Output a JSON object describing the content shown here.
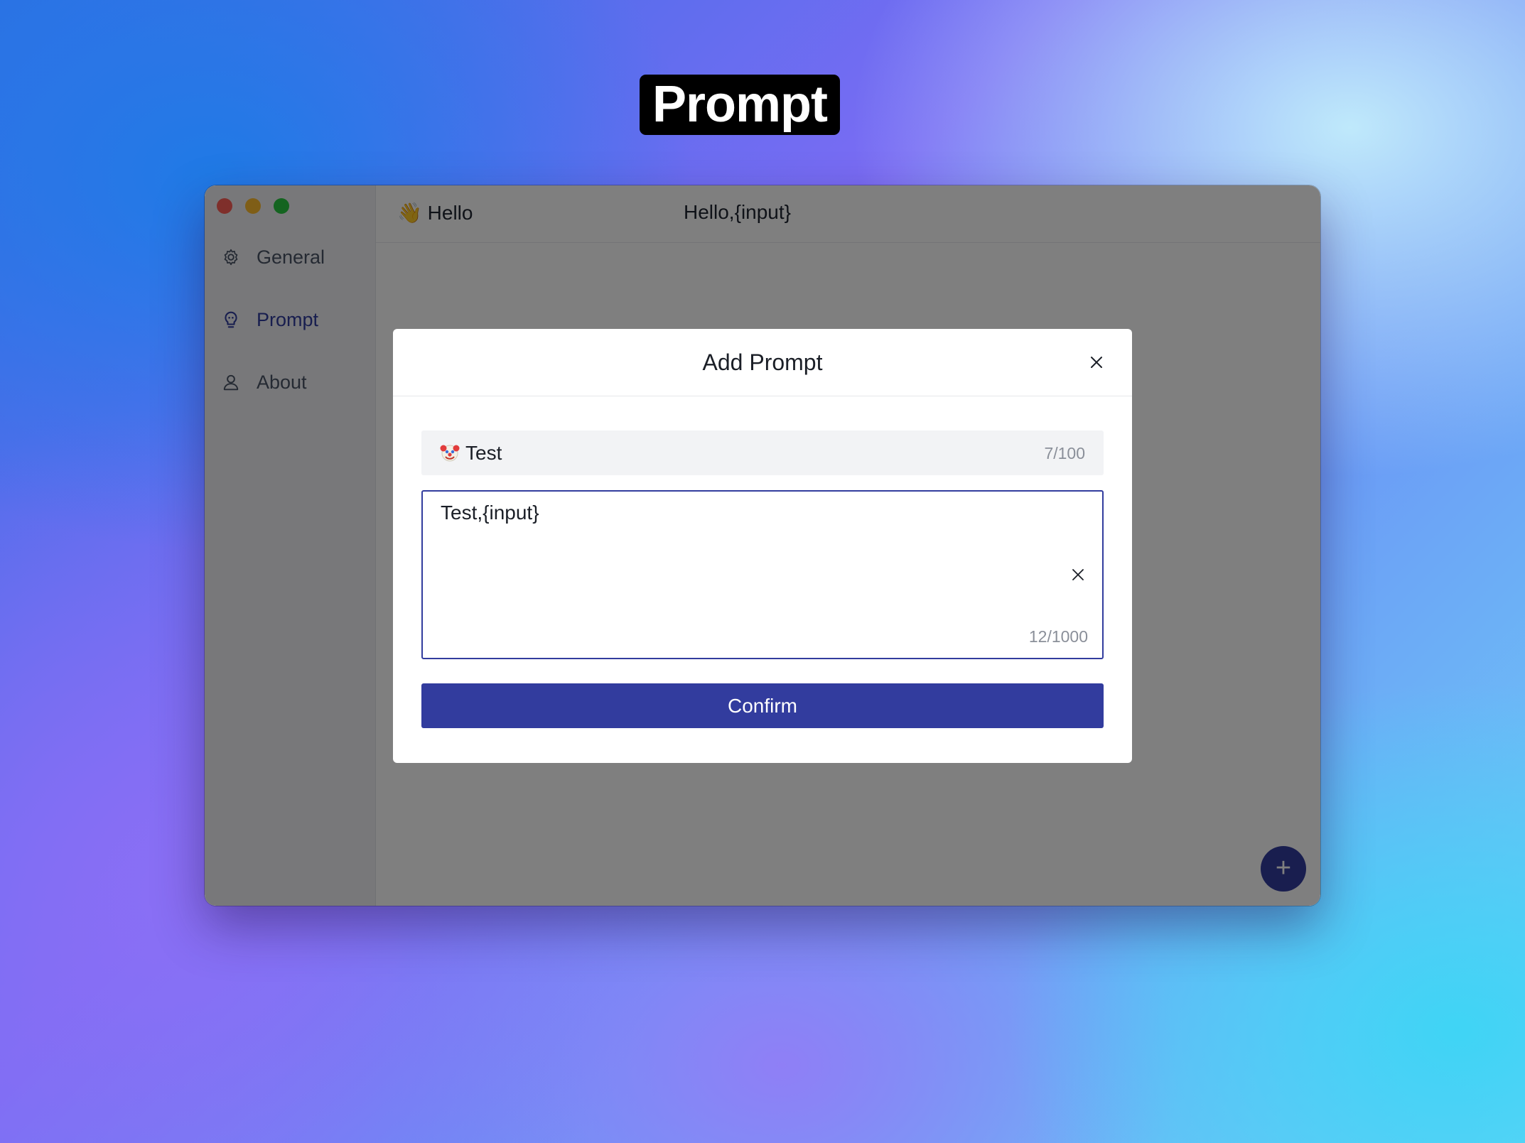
{
  "banner": {
    "title": "Prompt"
  },
  "window": {
    "controls": [
      "close",
      "minimize",
      "zoom"
    ]
  },
  "sidebar": {
    "items": [
      {
        "label": "General",
        "icon": "gear-icon",
        "active": false
      },
      {
        "label": "Prompt",
        "icon": "lightbulb-icon",
        "active": true
      },
      {
        "label": "About",
        "icon": "user-icon",
        "active": false
      }
    ]
  },
  "list": {
    "rows": [
      {
        "emoji": "👋",
        "name": "Hello",
        "prompt": "Hello,{input}"
      }
    ]
  },
  "fab": {
    "label": "+"
  },
  "modal": {
    "title": "Add Prompt",
    "name_field": {
      "emoji": "🤡",
      "value": "Test",
      "count": "7/100"
    },
    "prompt_field": {
      "value": "Test,{input}",
      "count": "12/1000"
    },
    "confirm_label": "Confirm"
  },
  "colors": {
    "accent": "#323c9e",
    "overlay": "rgba(0,0,0,0.5)"
  }
}
